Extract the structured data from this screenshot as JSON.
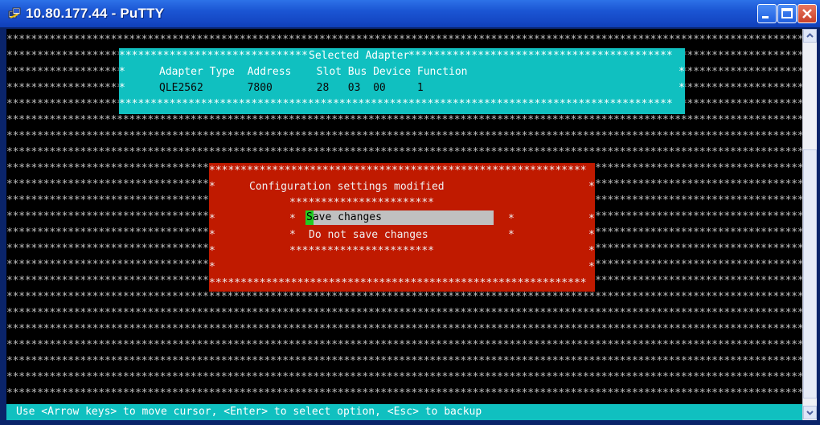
{
  "window": {
    "title": "10.80.177.44 - PuTTY"
  },
  "colors": {
    "cyan_panel": "#10c0c0",
    "red_panel": "#c01a00",
    "terminal_bg": "#000000",
    "cursor": "#22cc22",
    "highlight": "#c0c0c0"
  },
  "icons": {
    "app": "putty-icon",
    "minimize": "minimize-icon",
    "maximize": "maximize-icon",
    "close": "close-icon",
    "scroll_up": "scroll-up-icon",
    "scroll_down": "scroll-down-icon"
  },
  "adapter": {
    "heading": "Selected Adapter",
    "header_line": "Adapter Type  Address    Slot Bus Device Function",
    "values_line": "QLE2562       7800       28   03  00     1"
  },
  "dialog": {
    "heading": "Configuration settings modified",
    "options": [
      "Save changes",
      "Do not save changes"
    ],
    "selected_index": 0
  },
  "status": "Use <Arrow keys> to move cursor, <Enter> to select option, <Esc> to backup"
}
